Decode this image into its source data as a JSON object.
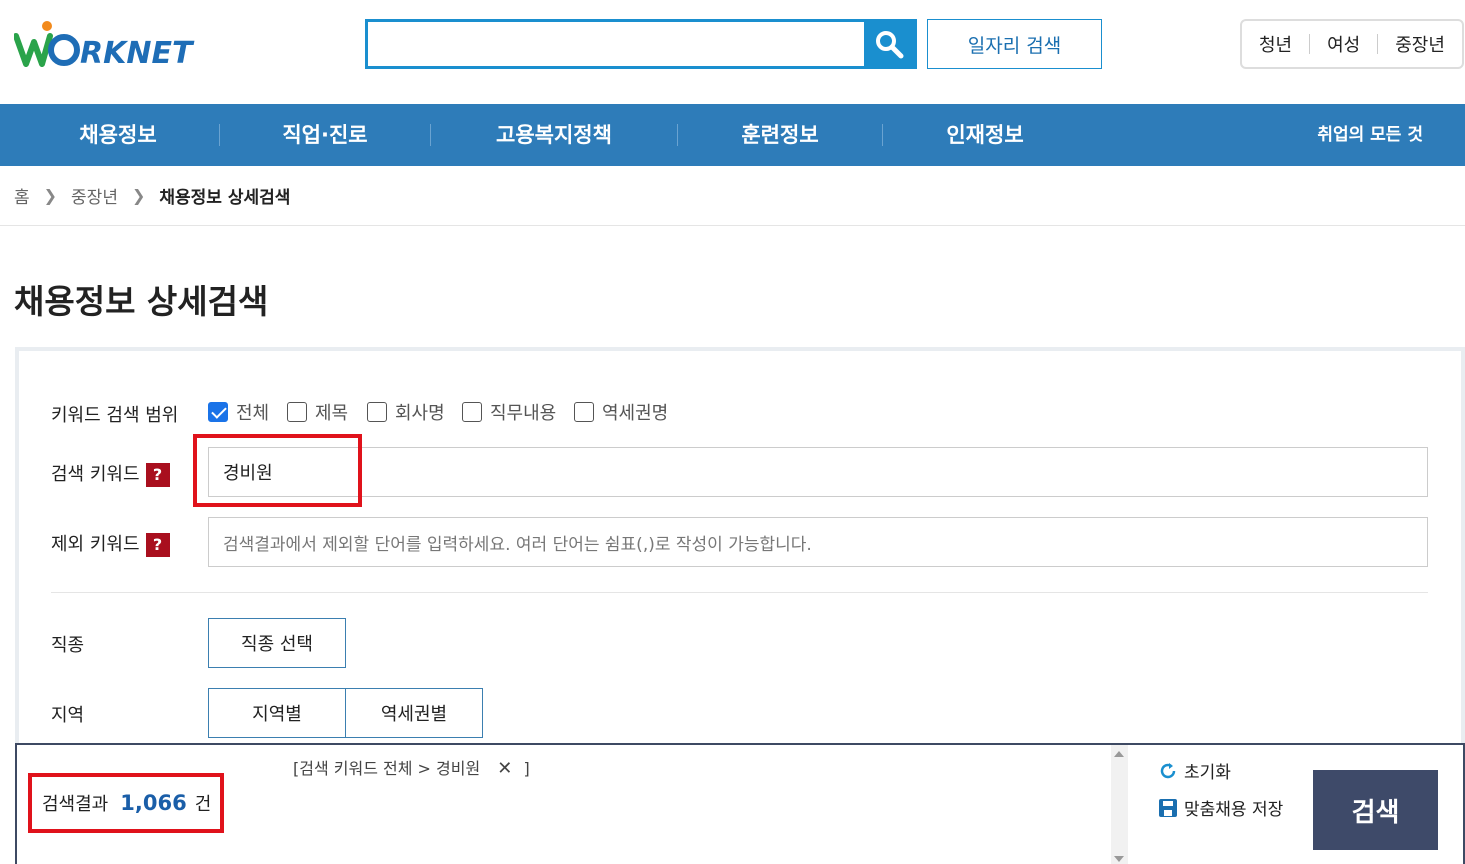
{
  "header": {
    "logo_text": "WORKNET",
    "search_placeholder": "",
    "job_search_label": "일자리 검색",
    "targets": [
      "청년",
      "여성",
      "중장년"
    ]
  },
  "nav": {
    "items": [
      "채용정보",
      "직업·진로",
      "고용복지정책",
      "훈련정보",
      "인재정보"
    ],
    "slogan": "취업의 모든 것"
  },
  "breadcrumb": [
    "홈",
    "중장년",
    "채용정보 상세검색"
  ],
  "page_title": "채용정보 상세검색",
  "form": {
    "scope_label": "키워드 검색 범위",
    "scope_options": [
      {
        "label": "전체",
        "checked": true
      },
      {
        "label": "제목",
        "checked": false
      },
      {
        "label": "회사명",
        "checked": false
      },
      {
        "label": "직무내용",
        "checked": false
      },
      {
        "label": "역세권명",
        "checked": false
      }
    ],
    "keyword_label": "검색 키워드",
    "keyword_value": "경비원",
    "exclude_label": "제외 키워드",
    "exclude_placeholder": "검색결과에서 제외할 단어를 입력하세요. 여러 단어는 쉼표(,)로 작성이 가능합니다.",
    "help_mark": "?",
    "job_label": "직종",
    "job_button": "직종 선택",
    "region_label": "지역",
    "region_buttons": [
      "지역별",
      "역세권별"
    ]
  },
  "result": {
    "tag_open": "[검색 키워드 전체 > 경비원",
    "tag_close": "]",
    "count_label": "검색결과",
    "count_value": "1,066",
    "count_unit": "건",
    "reset_label": "초기화",
    "save_label": "맞춤채용 저장",
    "search_label": "검색"
  },
  "colors": {
    "primary_blue": "#2e7cb9",
    "search_border": "#1a8fcf",
    "highlight_red": "#e0121b",
    "help_red": "#a90f1e",
    "search_button": "#3e4a69"
  }
}
